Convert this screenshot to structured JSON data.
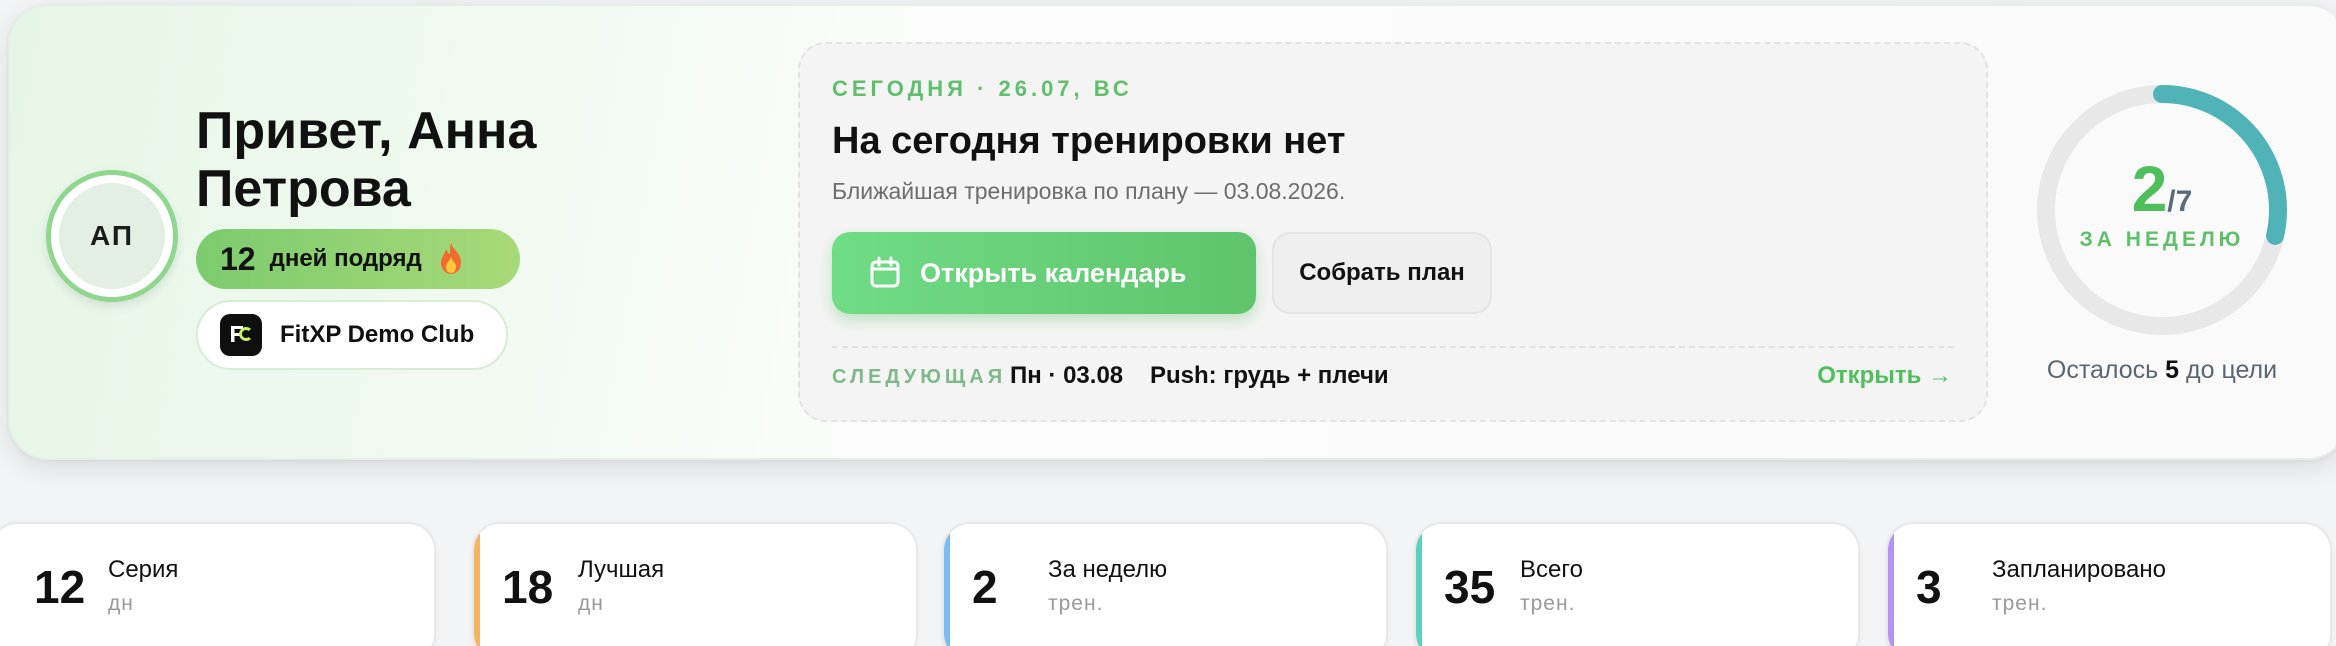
{
  "profile": {
    "initials": "АП",
    "greeting": "Привет, Анна Петрова",
    "streak_count": "12",
    "streak_text": "дней подряд",
    "club_name": "FitXP Demo Club"
  },
  "today": {
    "date_label": "СЕГОДНЯ · 26.07, ВС",
    "title": "На сегодня тренировки нет",
    "subtitle": "Ближайшая тренировка по плану — 03.08.2026.",
    "primary_button": "Открыть календарь",
    "secondary_button": "Собрать план",
    "next_label": "СЛЕДУЮЩАЯ",
    "next_date": "Пн · 03.08",
    "next_name": "Push: грудь + плечи",
    "next_open": "Открыть →"
  },
  "weekly": {
    "done": "2",
    "total": "/7",
    "progress": 0.2857,
    "label": "ЗА НЕДЕЛЮ",
    "remaining_prefix": "Осталось ",
    "remaining_value": "5",
    "remaining_suffix": " до цели"
  },
  "colors": {
    "brand_green": "#4fbf5b",
    "ring_teal": "#4fb3b8",
    "accent_series": "#ff8a78",
    "accent_best": "#f7b360",
    "accent_week": "#7dbbf0",
    "accent_total": "#5ed0bd",
    "accent_planned": "#b394f0"
  },
  "stats": [
    {
      "value": "12",
      "label": "Серия",
      "unit": "дн"
    },
    {
      "value": "18",
      "label": "Лучшая",
      "unit": "дн"
    },
    {
      "value": "2",
      "label": "За неделю",
      "unit": "трен."
    },
    {
      "value": "35",
      "label": "Всего",
      "unit": "трен."
    },
    {
      "value": "3",
      "label": "Запланировано",
      "unit": "трен."
    }
  ]
}
